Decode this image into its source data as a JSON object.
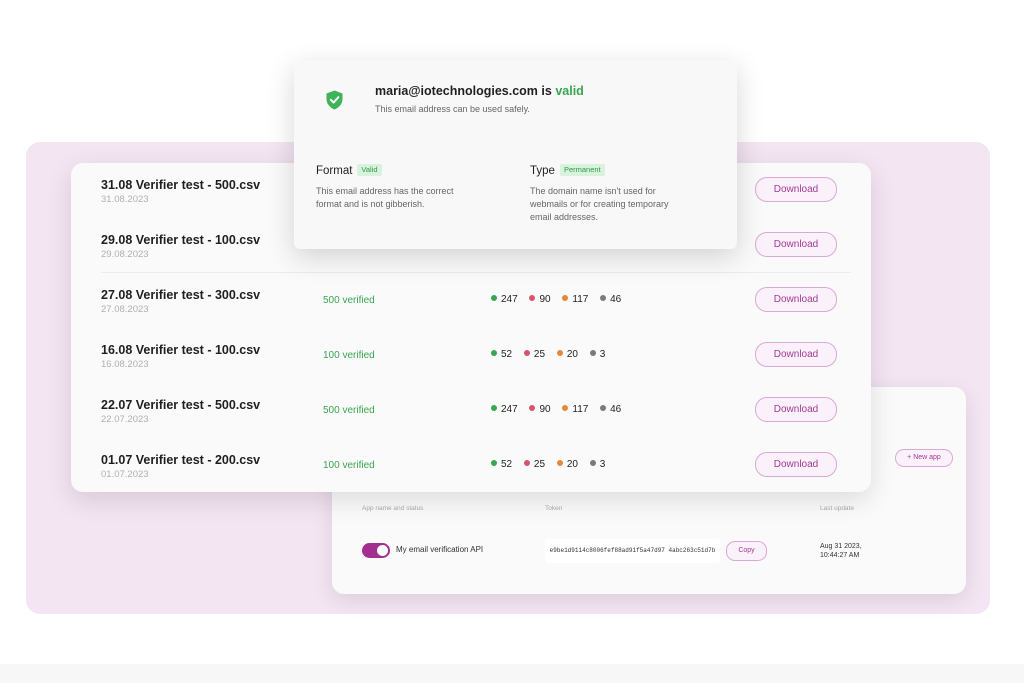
{
  "popup": {
    "email": "maria@iotechnologies.com",
    "is_word": "is",
    "status": "valid",
    "subtitle": "This email address can be used safely.",
    "format": {
      "label": "Format",
      "tag": "Valid",
      "description_lines": [
        "This email address has the correct",
        "format and is not gibberish."
      ]
    },
    "type": {
      "label": "Type",
      "tag": "Permanent",
      "description_lines": [
        "The domain name isn't used for",
        "webmails or for creating temporary",
        "email addresses."
      ]
    }
  },
  "files": [
    {
      "name": "31.08 Verifier test - 500.csv",
      "date": "31.08.2023",
      "verified": "",
      "stats": [],
      "download_label": "Download"
    },
    {
      "name": "29.08 Verifier test - 100.csv",
      "date": "29.08.2023",
      "verified": "",
      "stats": [],
      "download_label": "Download"
    },
    {
      "name": "27.08 Verifier test - 300.csv",
      "date": "27.08.2023",
      "verified": "500 verified",
      "stats": [
        "247",
        "90",
        "117",
        "46"
      ],
      "download_label": "Download"
    },
    {
      "name": "16.08 Verifier test - 100.csv",
      "date": "16.08.2023",
      "verified": "100 verified",
      "stats": [
        "52",
        "25",
        "20",
        "3"
      ],
      "download_label": "Download"
    },
    {
      "name": "22.07 Verifier test - 500.csv",
      "date": "22.07.2023",
      "verified": "500 verified",
      "stats": [
        "247",
        "90",
        "117",
        "46"
      ],
      "download_label": "Download"
    },
    {
      "name": "01.07 Verifier test - 200.csv",
      "date": "01.07.2023",
      "verified": "100 verified",
      "stats": [
        "52",
        "25",
        "20",
        "3"
      ],
      "download_label": "Download"
    }
  ],
  "stat_colors": [
    "#3aa552",
    "#d9546a",
    "#e08a3c",
    "#7b7b7b"
  ],
  "api": {
    "new_app_label": "+ New app",
    "headers": {
      "app": "App name and status",
      "token": "Token",
      "updated": "Last update"
    },
    "app_name": "My email verification API",
    "token": "e9be1d9114c8006fef88ad91f5a47d97 4abc263c51d7b",
    "copy_label": "Copy",
    "date_line1": "Aug 31 2023,",
    "date_line2": "10:44:27 AM"
  },
  "colors": {
    "accent": "#a23a96",
    "success": "#3aa552",
    "background": "#f3e5f2"
  }
}
